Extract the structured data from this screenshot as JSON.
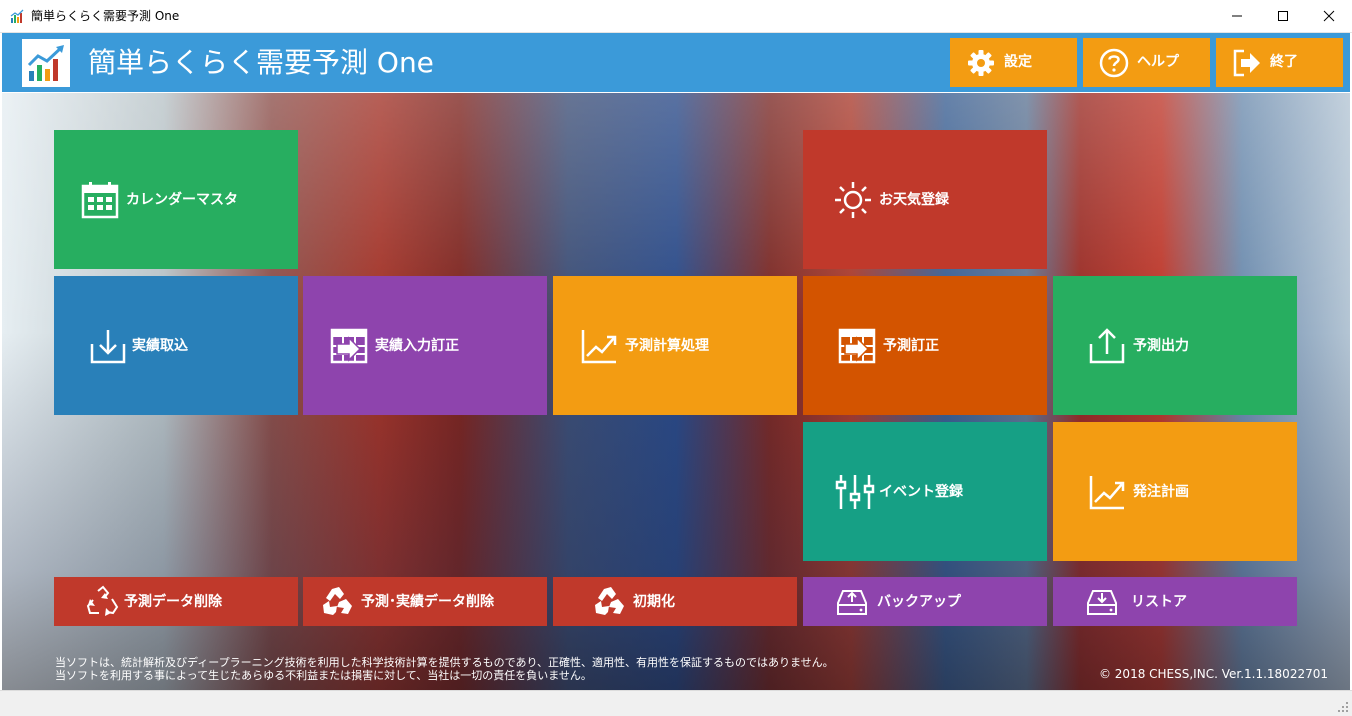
{
  "window": {
    "title": "簡単らくらく需要予測 One",
    "controls": [
      "minimize",
      "maximize",
      "close"
    ]
  },
  "header": {
    "app_title": "簡単らくらく需要予測 One",
    "buttons": [
      {
        "label": "設定",
        "icon": "gear-icon"
      },
      {
        "label": "ヘルプ",
        "icon": "help-icon"
      },
      {
        "label": "終了",
        "icon": "exit-icon"
      }
    ]
  },
  "tiles": {
    "calendar_master": {
      "label": "カレンダーマスタ",
      "icon": "calendar-icon"
    },
    "weather_register": {
      "label": "お天気登録",
      "icon": "sun-icon"
    },
    "actual_import": {
      "label": "実績取込",
      "icon": "import-icon"
    },
    "actual_edit": {
      "label": "実績入力訂正",
      "icon": "table-arrow-icon"
    },
    "forecast_calc": {
      "label": "予測計算処理",
      "icon": "trend-chart-icon"
    },
    "forecast_edit": {
      "label": "予測訂正",
      "icon": "table-arrow-icon"
    },
    "forecast_output": {
      "label": "予測出力",
      "icon": "export-icon"
    },
    "event_register": {
      "label": "イベント登録",
      "icon": "sliders-icon"
    },
    "order_plan": {
      "label": "発注計画",
      "icon": "trend-chart-icon"
    },
    "delete_forecast": {
      "label": "予測データ削除",
      "icon": "recycle-icon"
    },
    "delete_forecast_actual": {
      "label": "予測･実績データ削除",
      "icon": "recycle-icon"
    },
    "initialize": {
      "label": "初期化",
      "icon": "recycle-icon"
    },
    "backup": {
      "label": "バックアップ",
      "icon": "drive-upload-icon"
    },
    "restore": {
      "label": "リストア",
      "icon": "drive-download-icon"
    }
  },
  "footer": {
    "disclaimer_line1": "当ソフトは、統計解析及びディープラーニング技術を利用した科学技術計算を提供するものであり、正確性、適用性、有用性を保証するものではありません。",
    "disclaimer_line2": "当ソフトを利用する事によって生じたあらゆる不利益または損害に対して、当社は一切の責任を負いません。",
    "copyright": "© 2018 CHESS,INC. Ver.1.1.18022701"
  },
  "colors": {
    "header_blue": "#3b9ad9",
    "green": "#27ae60",
    "blue": "#2980b9",
    "purple": "#8e44ad",
    "orange": "#f39c12",
    "dark_orange": "#d35400",
    "red": "#c0392b",
    "teal": "#16a085"
  }
}
